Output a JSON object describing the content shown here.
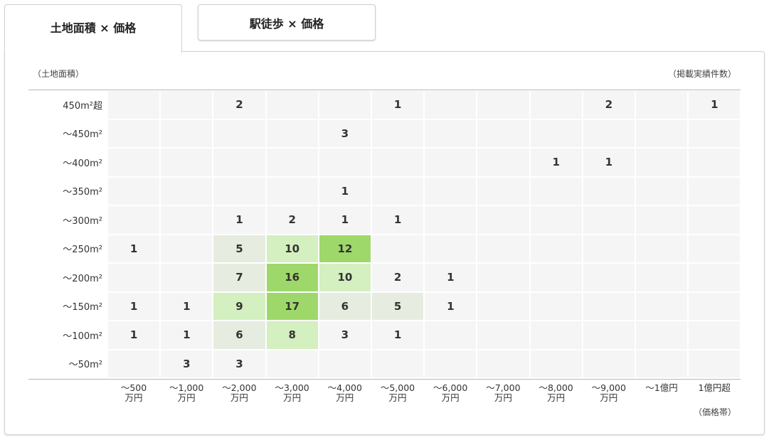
{
  "tabs": [
    {
      "label": "土地面積 × 価格",
      "active": true
    },
    {
      "label": "駅徒歩 × 価格",
      "active": false
    }
  ],
  "y_unit_label": "（土地面積）",
  "count_unit_label": "（掲載実績件数）",
  "x_unit_label": "（価格帯）",
  "colors": {
    "empty": "#f5f5f5",
    "low": "#e6ecdf",
    "mid": "#d4efc0",
    "high": "#9ed86a"
  },
  "chart_data": {
    "type": "heatmap",
    "x_categories": [
      "〜500\n万円",
      "〜1,000\n万円",
      "〜2,000\n万円",
      "〜3,000\n万円",
      "〜4,000\n万円",
      "〜5,000\n万円",
      "〜6,000\n万円",
      "〜7,000\n万円",
      "〜8,000\n万円",
      "〜9,000\n万円",
      "〜1億円",
      "1億円超"
    ],
    "y_categories": [
      "450m²超",
      "〜450m²",
      "〜400m²",
      "〜350m²",
      "〜300m²",
      "〜250m²",
      "〜200m²",
      "〜150m²",
      "〜100m²",
      "〜50m²"
    ],
    "values": [
      [
        null,
        null,
        2,
        null,
        null,
        1,
        null,
        null,
        null,
        2,
        null,
        1
      ],
      [
        null,
        null,
        null,
        null,
        3,
        null,
        null,
        null,
        null,
        null,
        null,
        null
      ],
      [
        null,
        null,
        null,
        null,
        null,
        null,
        null,
        null,
        1,
        1,
        null,
        null
      ],
      [
        null,
        null,
        null,
        null,
        1,
        null,
        null,
        null,
        null,
        null,
        null,
        null
      ],
      [
        null,
        null,
        1,
        2,
        1,
        1,
        null,
        null,
        null,
        null,
        null,
        null
      ],
      [
        1,
        null,
        5,
        10,
        12,
        null,
        null,
        null,
        null,
        null,
        null,
        null
      ],
      [
        null,
        null,
        7,
        16,
        10,
        2,
        1,
        null,
        null,
        null,
        null,
        null
      ],
      [
        1,
        1,
        9,
        17,
        6,
        5,
        1,
        null,
        null,
        null,
        null,
        null
      ],
      [
        1,
        1,
        6,
        8,
        3,
        1,
        null,
        null,
        null,
        null,
        null,
        null
      ],
      [
        null,
        3,
        3,
        null,
        null,
        null,
        null,
        null,
        null,
        null,
        null,
        null
      ]
    ]
  }
}
